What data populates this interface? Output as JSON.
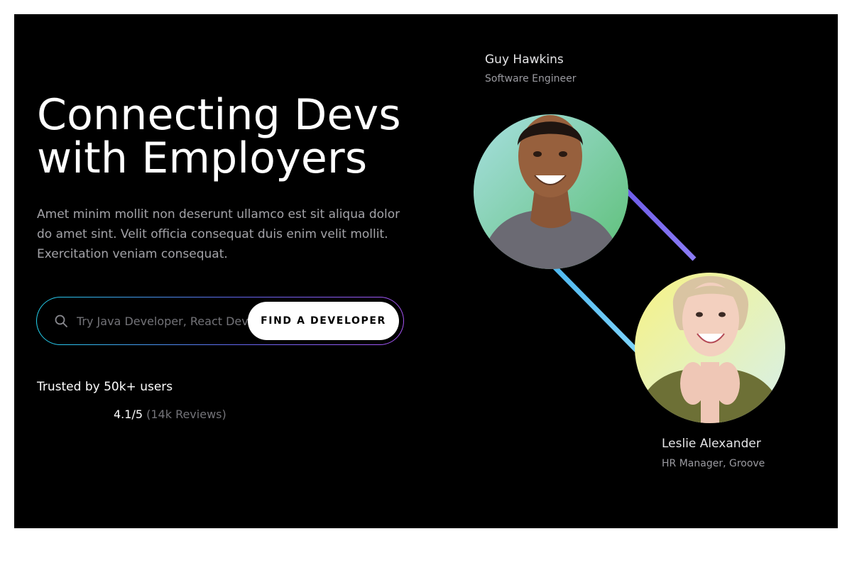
{
  "hero": {
    "headline_line1": "Connecting Devs",
    "headline_line2": "with Employers",
    "lede": "Amet minim mollit non deserunt ullamco est sit aliqua dolor do amet sint. Velit officia consequat duis enim velit mollit. Exercitation veniam consequat."
  },
  "search": {
    "placeholder": "Try Java Developer, React Dev",
    "button_label": "FIND A DEVELOPER",
    "icon": "search-icon"
  },
  "social_proof": {
    "trusted_text": "Trusted by 50k+ users",
    "rating": "4.1/5",
    "reviews": "(14k Reviews)"
  },
  "profiles": [
    {
      "name": "Guy Hawkins",
      "role": "Software Engineer"
    },
    {
      "name": "Leslie Alexander",
      "role": "HR Manager, Groove"
    }
  ],
  "colors": {
    "background": "#000000",
    "connector_purple": "#7c6cf0",
    "connector_blue": "#5ec8f5"
  }
}
